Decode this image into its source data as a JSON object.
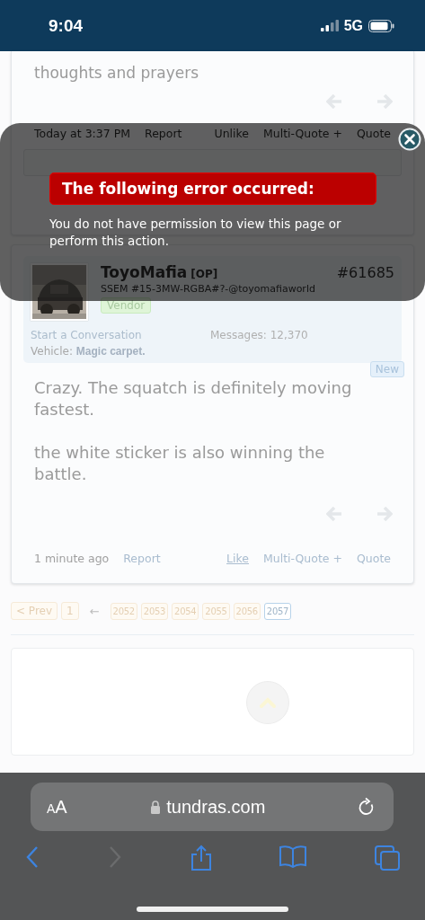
{
  "status_bar": {
    "time": "9:04",
    "network": "5G"
  },
  "posts": [
    {
      "kind": "tail",
      "body": [
        "thoughts and prayers"
      ],
      "footer": {
        "time": "Today at 3:37 PM",
        "report": "Report",
        "actions": [
          {
            "label": "Unlike",
            "underlined": false
          },
          {
            "label": "Multi-Quote +",
            "underlined": false
          },
          {
            "label": "Quote",
            "underlined": false
          }
        ]
      }
    },
    {
      "kind": "full",
      "author": {
        "name": "ToyoMafia",
        "tag": "[OP]",
        "title": "SSEM #15-3MW-RGBA#?-@toyomafiaworld",
        "badge": "Vendor",
        "start_conversation": "Start a Conversation",
        "messages_label": "Messages:",
        "messages": "12,370",
        "vehicle_label": "Vehicle:",
        "vehicle": "Magic carpet."
      },
      "number": "#61685",
      "new_badge": "New",
      "body": [
        "Crazy. The squatch is definitely moving fastest.",
        "the white sticker is also winning the battle."
      ],
      "footer": {
        "time": "1 minute ago",
        "report": "Report",
        "actions": [
          {
            "label": "Like",
            "underlined": true
          },
          {
            "label": "Multi-Quote +",
            "underlined": false
          },
          {
            "label": "Quote",
            "underlined": false
          }
        ]
      }
    }
  ],
  "pagination": {
    "prev": "< Prev",
    "pages": [
      {
        "label": "1",
        "selected": false
      },
      {
        "kind": "gap",
        "label": "←"
      },
      {
        "label": "2052",
        "selected": false
      },
      {
        "label": "2053",
        "selected": false
      },
      {
        "label": "2054",
        "selected": false
      },
      {
        "label": "2055",
        "selected": false
      },
      {
        "label": "2056",
        "selected": false
      },
      {
        "label": "2057",
        "selected": true
      }
    ]
  },
  "error_dialog": {
    "title": "The following error occurred:",
    "message": "You do not have permission to view this page or perform this action."
  },
  "browser": {
    "text_size": "AA",
    "url": "tundras.com"
  }
}
